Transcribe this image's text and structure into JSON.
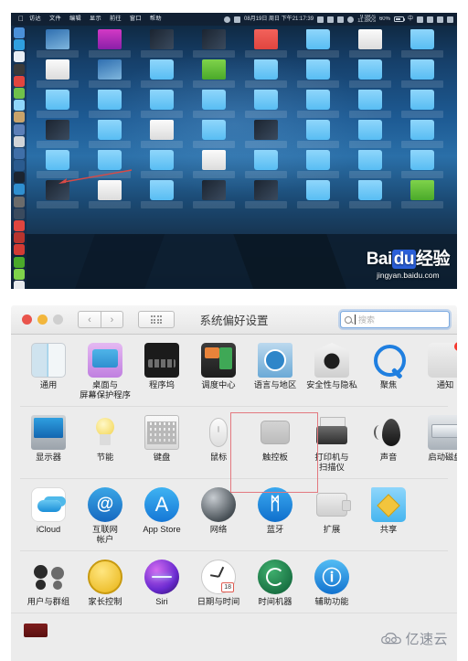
{
  "menubar": {
    "apple_icon": "apple-logo-icon",
    "items": [
      "访达",
      "文件",
      "编辑",
      "显示",
      "前往",
      "窗口",
      "帮助"
    ],
    "status": {
      "date_time": "08月19日 周日 下午21:17:39",
      "network_speed_up": "9.9K/s",
      "network_speed_down": "11.8K/s",
      "battery_percent": "60%",
      "input_method": "中",
      "icons": [
        "screen-mirroring-icon",
        "calendar-icon",
        "display-icon",
        "monitor-icon",
        "app-icon",
        "wifi-icon",
        "battery-icon",
        "input-method-icon",
        "sync-icon",
        "bluetooth-icon",
        "star-icon",
        "menu-list-icon"
      ]
    }
  },
  "desktop": {
    "dock_icon_count": 22,
    "file_icon_rows": 6,
    "file_icons_per_row": 8,
    "watermark": {
      "brand_prefix": "Bai",
      "brand_mid": "du",
      "brand_suffix": "经验",
      "url": "jingyan.baidu.com"
    },
    "annotation": "red-arrow"
  },
  "syspref": {
    "titlebar": {
      "title": "系统偏好设置",
      "traffic_lights": [
        "close-button",
        "minimize-button",
        "zoom-button"
      ],
      "back_label": "‹",
      "forward_label": "›",
      "grid_label": "show-all-grid-button"
    },
    "search": {
      "placeholder": "搜索",
      "value": ""
    },
    "rows": [
      {
        "items": [
          {
            "label": "通用",
            "icon": "general-icon",
            "cls": "ic-general"
          },
          {
            "label": "桌面与\n屏幕保护程序",
            "icon": "desktop-screensaver-icon",
            "cls": "ic-desktop"
          },
          {
            "label": "程序坞",
            "icon": "dock-icon",
            "cls": "ic-dock"
          },
          {
            "label": "调度中心",
            "icon": "mission-control-icon",
            "cls": "ic-mission"
          },
          {
            "label": "语言与地区",
            "icon": "language-region-icon",
            "cls": "ic-lang"
          },
          {
            "label": "安全性与隐私",
            "icon": "security-privacy-icon",
            "cls": "ic-security"
          },
          {
            "label": "聚焦",
            "icon": "spotlight-icon",
            "cls": "ic-spotlight"
          },
          {
            "label": "通知",
            "icon": "notifications-icon",
            "cls": "ic-notif",
            "badge": true
          }
        ]
      },
      {
        "items": [
          {
            "label": "显示器",
            "icon": "displays-icon",
            "cls": "ic-display"
          },
          {
            "label": "节能",
            "icon": "energy-saver-icon",
            "cls": "ic-energy"
          },
          {
            "label": "键盘",
            "icon": "keyboard-icon",
            "cls": "ic-keyboard"
          },
          {
            "label": "鼠标",
            "icon": "mouse-icon",
            "cls": "ic-mouse"
          },
          {
            "label": "触控板",
            "icon": "trackpad-icon",
            "cls": "ic-trackpad",
            "highlighted": true
          },
          {
            "label": "打印机与\n扫描仪",
            "icon": "printers-scanners-icon",
            "cls": "ic-printer"
          },
          {
            "label": "声音",
            "icon": "sound-icon",
            "cls": "ic-sound"
          },
          {
            "label": "启动磁盘",
            "icon": "startup-disk-icon",
            "cls": "ic-startup"
          }
        ]
      },
      {
        "items": [
          {
            "label": "iCloud",
            "icon": "icloud-icon",
            "cls": "ic-icloud"
          },
          {
            "label": "互联网\n帐户",
            "icon": "internet-accounts-icon",
            "cls": "ic-circle ic-internet",
            "glyph": "@"
          },
          {
            "label": "App Store",
            "icon": "app-store-icon",
            "cls": "ic-circle ic-appstore",
            "glyph": "A"
          },
          {
            "label": "网络",
            "icon": "network-icon",
            "cls": "ic-circle ic-network",
            "glyph": ""
          },
          {
            "label": "蓝牙",
            "icon": "bluetooth-icon",
            "cls": "ic-circle ic-bt",
            "glyph": "ᛗ"
          },
          {
            "label": "扩展",
            "icon": "extensions-icon",
            "cls": "ic-ext"
          },
          {
            "label": "共享",
            "icon": "sharing-icon",
            "cls": "ic-share"
          }
        ]
      },
      {
        "items": [
          {
            "label": "用户与群组",
            "icon": "users-groups-icon",
            "cls": "ic-users"
          },
          {
            "label": "家长控制",
            "icon": "parental-controls-icon",
            "cls": "ic-parental"
          },
          {
            "label": "Siri",
            "icon": "siri-icon",
            "cls": "ic-siri"
          },
          {
            "label": "日期与时间",
            "icon": "date-time-icon",
            "cls": "ic-datetime",
            "day": "18"
          },
          {
            "label": "时间机器",
            "icon": "time-machine-icon",
            "cls": "ic-tm"
          },
          {
            "label": "辅助功能",
            "icon": "accessibility-icon",
            "cls": "ic-access",
            "glyph": "ⓘ"
          }
        ]
      }
    ],
    "highlight": {
      "color": "#e3797f",
      "target_label": "触控板"
    }
  },
  "watermark_bottom": {
    "text": "亿速云",
    "icon": "cloud-logo-icon"
  }
}
